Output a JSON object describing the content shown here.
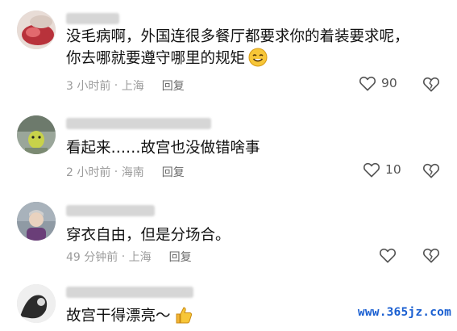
{
  "comments": [
    {
      "text_lines": [
        "没毛病啊，外国连很多餐厅都要求你的着装要求呢，",
        "你去哪就要遵守哪里的规矩"
      ],
      "time": "3 小时前",
      "location": "上海",
      "reply_label": "回复",
      "likes": "90",
      "emoji_icon": "smile-emoji-icon"
    },
    {
      "text_lines": [
        "看起来……故宫也没做错啥事"
      ],
      "time": "2 小时前",
      "location": "海南",
      "reply_label": "回复",
      "likes": "10"
    },
    {
      "text_lines": [
        "穿衣自由，但是分场合。"
      ],
      "time": "49 分钟前",
      "location": "上海",
      "reply_label": "回复",
      "likes": ""
    },
    {
      "text_lines": [
        "故宫干得漂亮～"
      ],
      "emoji_icon": "thumbs-up-icon"
    }
  ],
  "separator": " · ",
  "watermark": "www.365jz.com",
  "colors": {
    "text": "#111111",
    "meta": "#9b9b9b",
    "icon": "#555555",
    "watermark": "#1a5fd1"
  }
}
